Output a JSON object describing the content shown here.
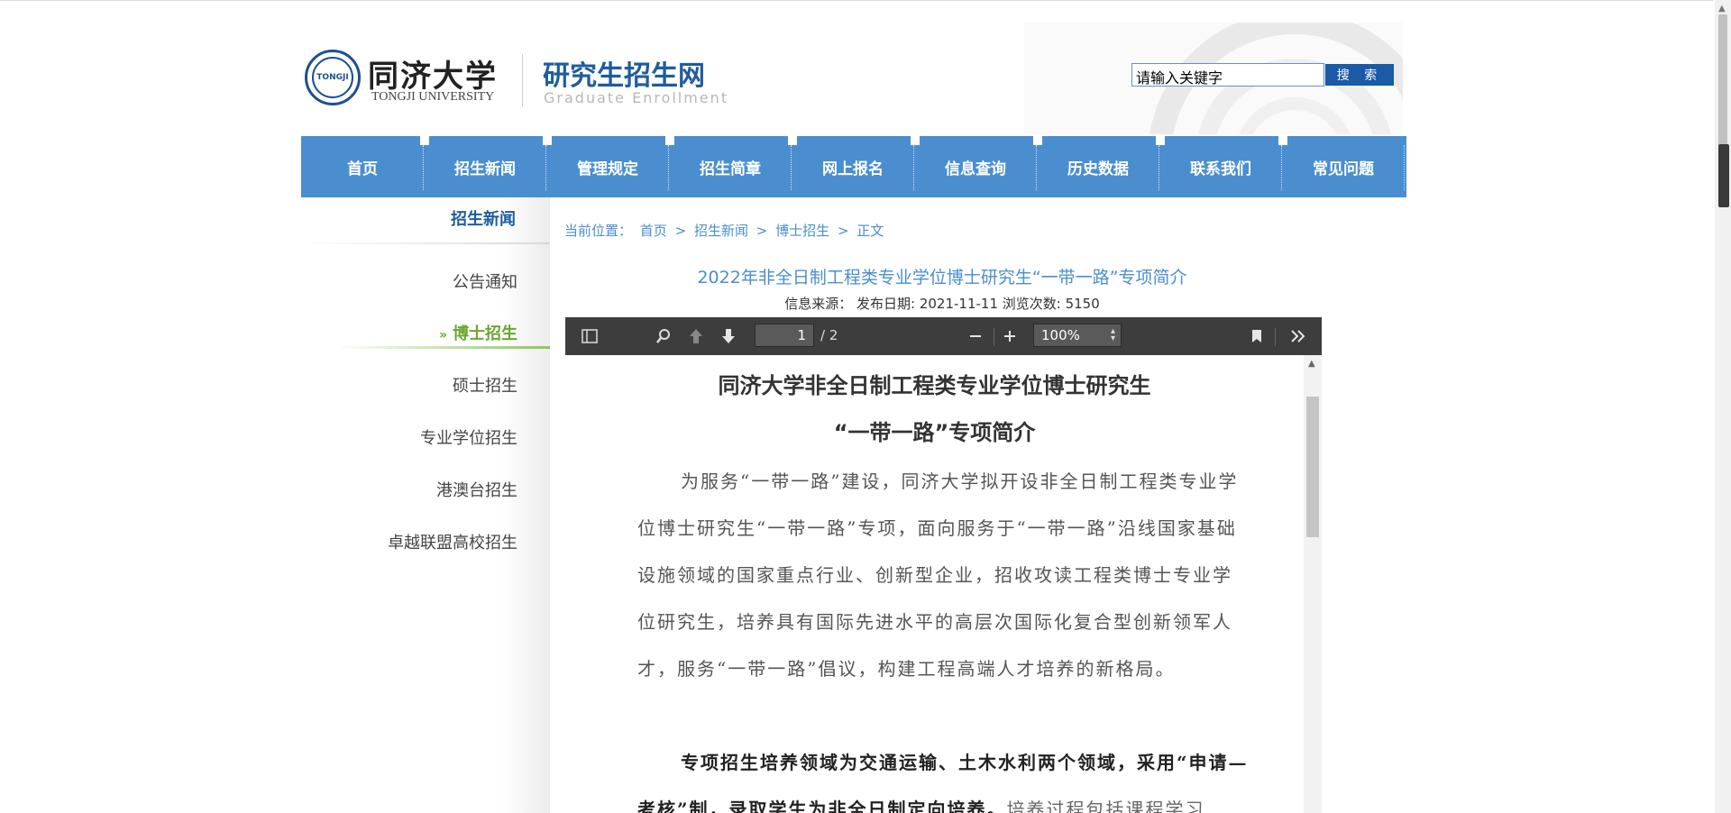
{
  "header": {
    "university_cn": "同济大学",
    "university_en": "TONGJI UNIVERSITY",
    "seal_text": "TONGJI",
    "site_cn": "研究生招生网",
    "site_en": "Graduate Enrollment"
  },
  "search": {
    "value": "请输入关键字",
    "button": "搜 索"
  },
  "nav": {
    "items": [
      "首页",
      "招生新闻",
      "管理规定",
      "招生简章",
      "网上报名",
      "信息查询",
      "历史数据",
      "联系我们",
      "常见问题"
    ]
  },
  "sidebar": {
    "title": "招生新闻",
    "items": [
      "公告通知",
      "博士招生",
      "硕士招生",
      "专业学位招生",
      "港澳台招生",
      "卓越联盟高校招生"
    ],
    "active_marker": "»"
  },
  "breadcrumb": {
    "prefix": "当前位置：",
    "items": [
      "首页",
      ">",
      "招生新闻",
      ">",
      "博士招生",
      ">",
      "正文"
    ]
  },
  "article": {
    "title": "2022年非全日制工程类专业学位博士研究生“一带一路”专项简介",
    "meta": "信息来源：  发布日期: 2021-11-11 浏览次数: 5150"
  },
  "pdf_viewer": {
    "page_current": "1",
    "page_total": "/ 2",
    "zoom": "100%",
    "icons": [
      "sidebar-toggle-icon",
      "search-icon",
      "previous-page-icon",
      "next-page-icon",
      "zoom-out-icon",
      "zoom-in-icon",
      "bookmark-icon",
      "tools-icon"
    ],
    "doc_title_line1": "同济大学非全日制工程类专业学位博士研究生",
    "doc_title_line2": "“一带一路”专项简介",
    "paragraph1": "为服务“一带一路”建设，同济大学拟开设非全日制工程类专业学位博士研究生“一带一路”专项，面向服务于“一带一路”沿线国家基础设施领域的国家重点行业、创新型企业，招收攻读工程类博士专业学位研究生，培养具有国际先进水平的高层次国际化复合型创新领军人才，服务“一带一路”倡议，构建工程高端人才培养的新格局。",
    "paragraph2_bold": "专项招生培养领域为交通运输、土木水利两个领域，采用“申请—考核”制，录取学生为非全日制定向培养。",
    "paragraph2_rest": "培养过程包括课程学习"
  },
  "colors": {
    "nav_bg": "#4a8ed0",
    "brand_blue": "#1f5c9e",
    "active_green": "#69a82e",
    "pdf_toolbar": "#3d3d3d"
  }
}
